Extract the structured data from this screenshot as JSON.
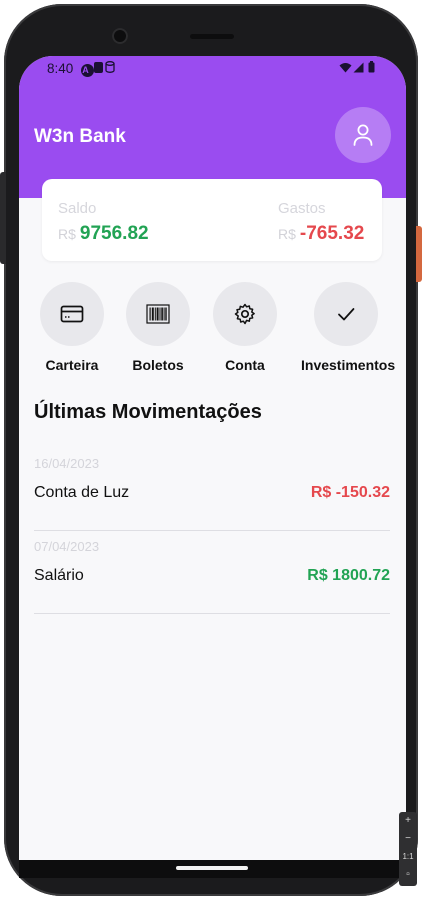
{
  "status_bar": {
    "time": "8:40",
    "left_icons": [
      "android-icon",
      "sd-card-icon",
      "database-icon"
    ],
    "right_icons": [
      "wifi-icon",
      "signal-icon",
      "battery-icon"
    ]
  },
  "app": {
    "title": "W3n Bank",
    "brand_color": "#9a4cf0",
    "avatar_icon": "user-icon"
  },
  "balance": {
    "saldo_label": "Saldo",
    "saldo_currency": "R$",
    "saldo_value": "9756.82",
    "gastos_label": "Gastos",
    "gastos_currency": "R$",
    "gastos_value": "-765.32",
    "positive_color": "#22a354",
    "negative_color": "#e5484d"
  },
  "actions": [
    {
      "label": "Carteira",
      "icon": "credit-card-icon"
    },
    {
      "label": "Boletos",
      "icon": "barcode-icon"
    },
    {
      "label": "Conta",
      "icon": "gear-icon"
    },
    {
      "label": "Investimentos",
      "icon": "check-icon"
    }
  ],
  "movements": {
    "title": "Últimas Movimentações",
    "items": [
      {
        "date": "16/04/2023",
        "description": "Conta de Luz",
        "amount": "R$ -150.32",
        "type": "expense"
      },
      {
        "date": "07/04/2023",
        "description": "Salário",
        "amount": "R$ 1800.72",
        "type": "income"
      }
    ]
  },
  "emulator_zoom": {
    "plus": "+",
    "minus": "−",
    "ratio": "1:1"
  }
}
